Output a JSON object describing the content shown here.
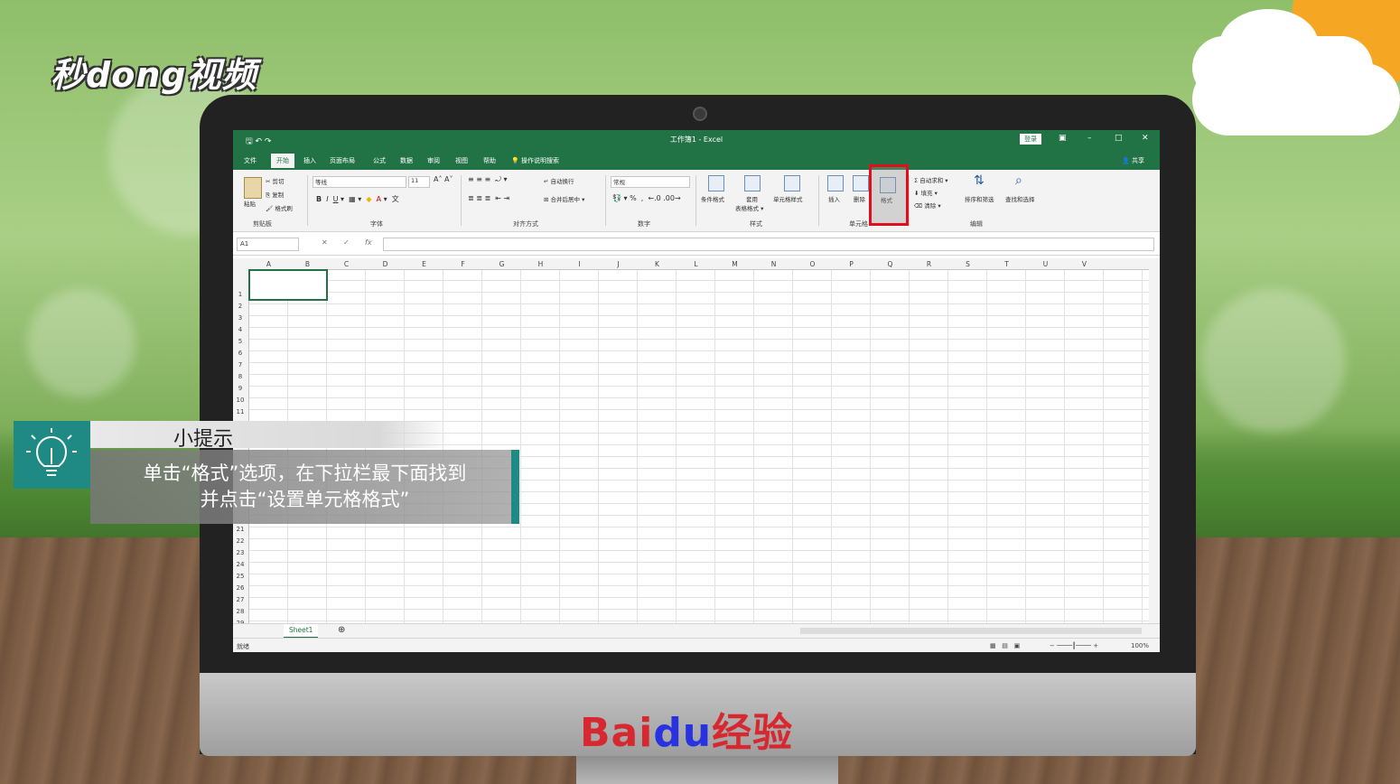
{
  "watermark_top": "秒dong视频",
  "watermark_bottom": {
    "bai": "Bai",
    "du": "du",
    "jingyan": "经验"
  },
  "excel": {
    "title": "工作簿1 - Excel",
    "login_label": "登录",
    "share_label": "共享",
    "menu": [
      "文件",
      "开始",
      "插入",
      "页面布局",
      "公式",
      "数据",
      "审阅",
      "视图",
      "帮助",
      "操作说明搜索"
    ],
    "ribbon": {
      "paste": "粘贴",
      "cut": "剪切",
      "copy": "复制",
      "format_painter": "格式刷",
      "clipboard": "剪贴板",
      "font_name": "等线",
      "font_size": "11",
      "font_group": "字体",
      "wrap_text": "自动换行",
      "merge_center": "合并后居中",
      "alignment_group": "对齐方式",
      "number_format": "常规",
      "number_group": "数字",
      "conditional_format": "条件格式",
      "table_format": "套用表格格式",
      "cell_styles": "单元格样式",
      "styles_group": "样式",
      "insert": "插入",
      "delete": "删除",
      "format": "格式",
      "cells_group": "单元格",
      "autosum": "自动求和",
      "fill": "填充",
      "clear": "清除",
      "sort_filter": "排序和筛选",
      "find_select": "查找和选择",
      "editing_group": "编辑"
    },
    "name_box": "A1",
    "fx": "fx",
    "columns": [
      "A",
      "B",
      "C",
      "D",
      "E",
      "F",
      "G",
      "H",
      "I",
      "J",
      "K",
      "L",
      "M",
      "N",
      "O",
      "P",
      "Q",
      "R",
      "S",
      "T",
      "U",
      "V"
    ],
    "rows": [
      "1",
      "2",
      "3",
      "4",
      "5",
      "6",
      "7",
      "8",
      "9",
      "10",
      "11",
      "21",
      "22",
      "23",
      "24",
      "25",
      "26",
      "27",
      "28",
      "29"
    ],
    "sheet_tab": "Sheet1",
    "status_ready": "就绪",
    "zoom": "100%"
  },
  "tip": {
    "title": "小提示",
    "line1": "单击“格式”选项，在下拉栏最下面找到",
    "line2": "并点击“设置单元格格式”"
  },
  "colors": {
    "excel_green": "#217346",
    "highlight_red": "#e0101a",
    "tip_teal": "#1f8a83"
  }
}
